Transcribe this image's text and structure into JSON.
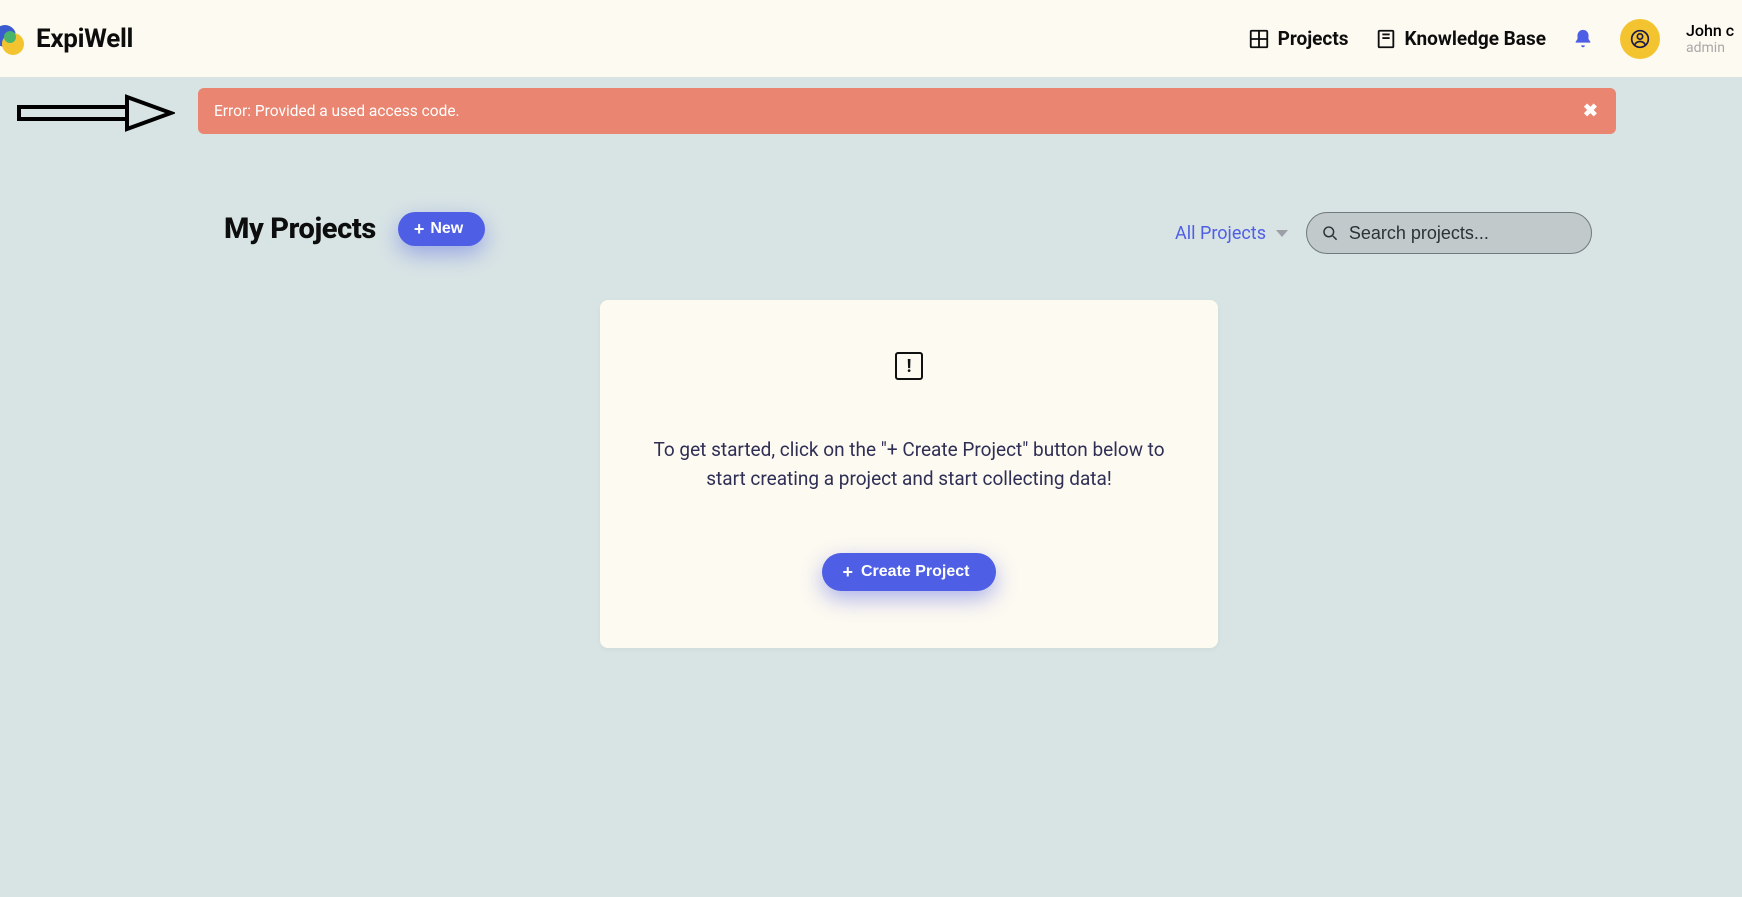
{
  "brand": {
    "name": "ExpiWell"
  },
  "nav": {
    "projects": "Projects",
    "knowledge_base": "Knowledge Base"
  },
  "user": {
    "name": "John c",
    "role": "admin"
  },
  "alert": {
    "message": "Error: Provided a used access code."
  },
  "page": {
    "title": "My Projects",
    "new_label": "New"
  },
  "filter": {
    "label": "All Projects",
    "search_placeholder": "Search projects..."
  },
  "empty_card": {
    "message": "To get started, click on the \"+ Create Project\" button below to start creating a project and start collecting data!",
    "button_label": "Create Project"
  }
}
